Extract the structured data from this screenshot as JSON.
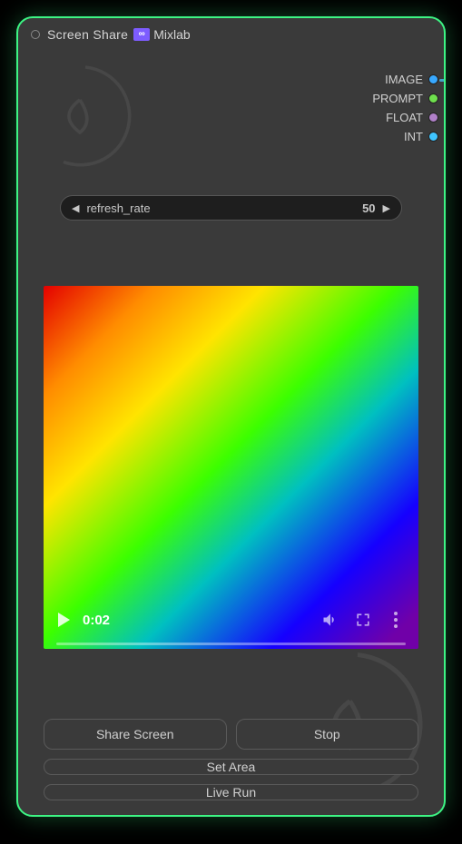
{
  "header": {
    "title": "Screen Share",
    "badge_icon": "∞",
    "badge_label": "Mixlab"
  },
  "outputs": [
    {
      "label": "IMAGE",
      "color": "blue",
      "connected": true
    },
    {
      "label": "PROMPT",
      "color": "green",
      "connected": false
    },
    {
      "label": "FLOAT",
      "color": "purple",
      "connected": false
    },
    {
      "label": "INT",
      "color": "cyan",
      "connected": false
    }
  ],
  "param": {
    "label": "refresh_rate",
    "value": "50"
  },
  "video": {
    "time": "0:02"
  },
  "buttons": {
    "share": "Share Screen",
    "stop": "Stop",
    "set_area": "Set Area",
    "live_run": "Live Run"
  }
}
